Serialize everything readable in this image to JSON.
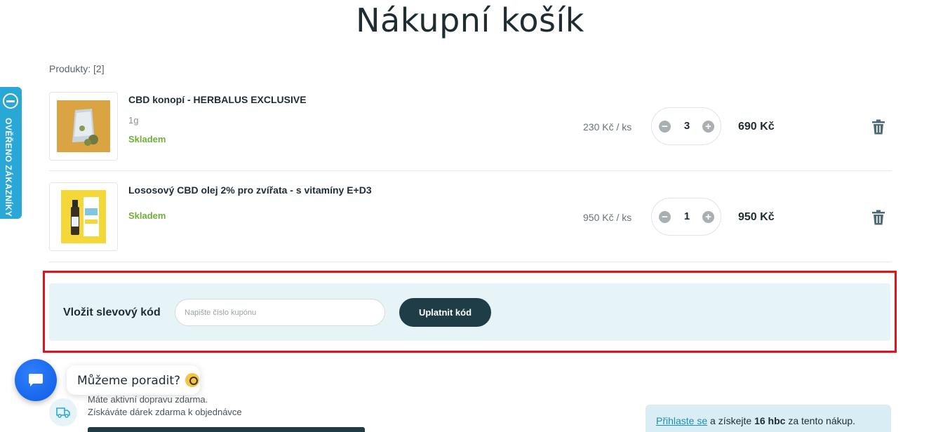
{
  "page": {
    "title": "Nákupní košík",
    "products_count": "Produkty: [2]"
  },
  "cart": {
    "items": [
      {
        "name": "CBD konopí - HERBALUS EXCLUSIVE",
        "variant": "1g",
        "stock": "Skladem",
        "unit_price": "230 Kč / ks",
        "quantity": "3",
        "total": "690 Kč"
      },
      {
        "name": "Lososový CBD olej 2% pro zvířata - s vitamíny E+D3",
        "variant": "",
        "stock": "Skladem",
        "unit_price": "950 Kč / ks",
        "quantity": "1",
        "total": "950 Kč"
      }
    ],
    "minus_symbol": "−",
    "plus_symbol": "+"
  },
  "coupon": {
    "label": "Vložit slevový kód",
    "placeholder": "Napište číslo kupónu",
    "value": "",
    "button": "Uplatnit kód"
  },
  "side_badge": {
    "text": "OVĚŘENO ZÁKAZNÍKY"
  },
  "chat": {
    "bubble_text": "Můžeme poradit?"
  },
  "shipping": {
    "line1": "Máte aktivní dopravu zdarma.",
    "line2": "Získáváte dárek zdarma k objednávce",
    "progress_fraction": 1.0
  },
  "login_promo": {
    "link": "Přihlaste se",
    "middle": " a získejte ",
    "points": "16 hbc",
    "end": " za tento nákup."
  },
  "colors": {
    "accent_dark": "#1f3d47",
    "stock_green": "#6fae3a",
    "badge_blue": "#29a8d8",
    "coupon_bg": "#e6f4f7",
    "highlight_red": "#e3131b"
  }
}
